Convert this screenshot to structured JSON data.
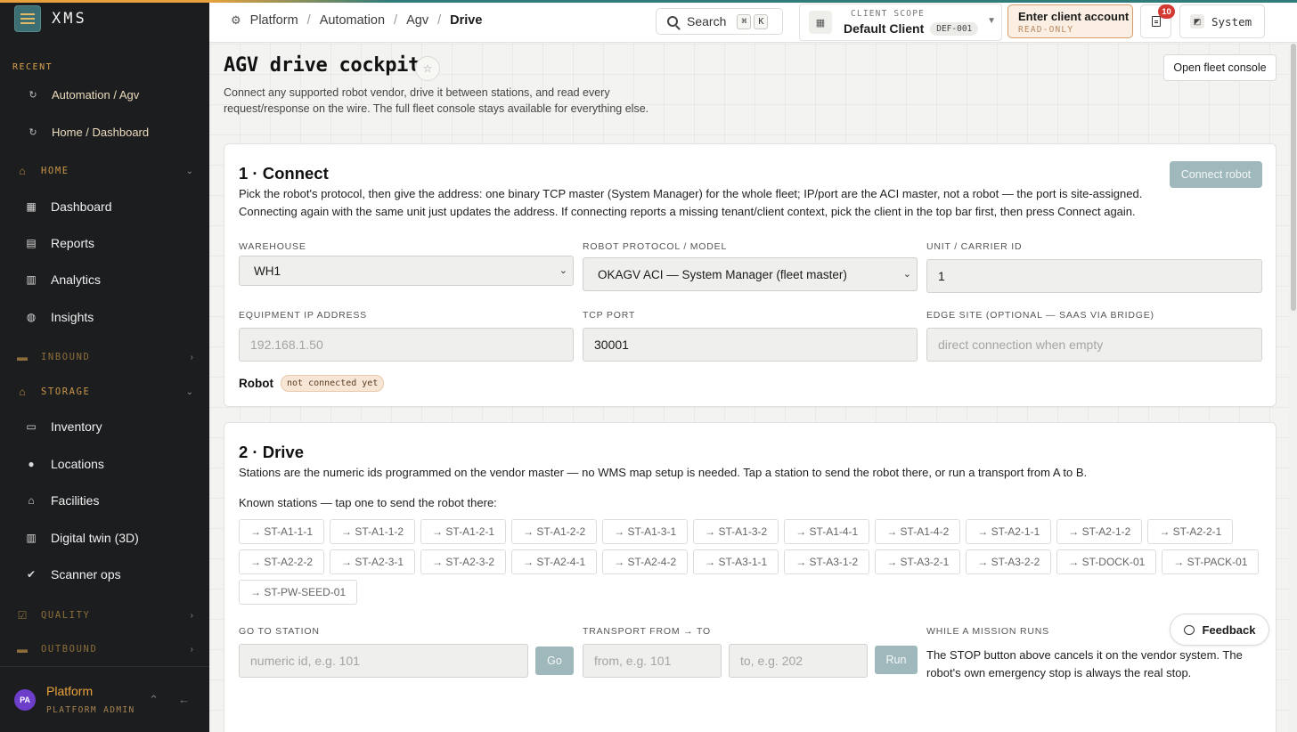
{
  "sidebar": {
    "brand": "XMS",
    "recent_label": "RECENT",
    "recent": [
      {
        "label": "Automation / Agv"
      },
      {
        "label": "Home / Dashboard"
      }
    ],
    "groups": {
      "home": "HOME",
      "inbound": "INBOUND",
      "storage": "STORAGE",
      "quality": "QUALITY",
      "outbound": "OUTBOUND"
    },
    "home_items": [
      {
        "label": "Dashboard",
        "icon": "grid-icon"
      },
      {
        "label": "Reports",
        "icon": "document-icon"
      },
      {
        "label": "Analytics",
        "icon": "bar-chart-icon"
      },
      {
        "label": "Insights",
        "icon": "globe-icon"
      }
    ],
    "storage_items": [
      {
        "label": "Inventory",
        "icon": "box-icon"
      },
      {
        "label": "Locations",
        "icon": "pin-icon"
      },
      {
        "label": "Facilities",
        "icon": "warehouse-icon"
      },
      {
        "label": "Digital twin (3D)",
        "icon": "chart-icon"
      },
      {
        "label": "Scanner ops",
        "icon": "shield-check-icon"
      }
    ],
    "user": {
      "initials": "PA",
      "name": "Platform",
      "role": "PLATFORM ADMIN"
    }
  },
  "topbar": {
    "breadcrumb": [
      "Platform",
      "Automation",
      "Agv",
      "Drive"
    ],
    "search_label": "Search",
    "search_keys": [
      "⌘",
      "K"
    ],
    "scope_label": "CLIENT SCOPE",
    "scope_value": "Default Client",
    "scope_code": "DEF-001",
    "enter_client": "Enter client account",
    "enter_client_sub": "READ-ONLY",
    "notifications_count": "10",
    "system_label": "System"
  },
  "page": {
    "title": "AGV drive cockpit",
    "description": "Connect any supported robot vendor, drive it between stations, and read every request/response on the wire. The full fleet console stays available for everything else.",
    "fleet_button": "Open fleet console"
  },
  "connect": {
    "title": "1 · Connect",
    "description": "Pick the robot's protocol, then give the address: one binary TCP master (System Manager) for the whole fleet; IP/port are the ACI master, not a robot — the port is site-assigned. Connecting again with the same unit just updates the address. If connecting reports a missing tenant/client context, pick the client in the top bar first, then press Connect again.",
    "button": "Connect robot",
    "warehouse_label": "WAREHOUSE",
    "warehouse_value": "WH1",
    "protocol_label": "ROBOT PROTOCOL / MODEL",
    "protocol_value": "OKAGV ACI — System Manager (fleet master)",
    "unit_label": "UNIT / CARRIER ID",
    "unit_value": "1",
    "ip_label": "EQUIPMENT IP ADDRESS",
    "ip_placeholder": "192.168.1.50",
    "port_label": "TCP PORT",
    "port_value": "30001",
    "edge_label": "EDGE SITE (OPTIONAL — SAAS VIA BRIDGE)",
    "edge_placeholder": "direct connection when empty",
    "robot_label": "Robot",
    "robot_status": "not connected yet"
  },
  "drive": {
    "title": "2 · Drive",
    "description": "Stations are the numeric ids programmed on the vendor master — no WMS map setup is needed. Tap a station to send the robot there, or run a transport from A to B.",
    "stations_heading": "Known stations — tap one to send the robot there:",
    "stations": [
      "→ ST-A1-1-1",
      "→ ST-A1-1-2",
      "→ ST-A1-2-1",
      "→ ST-A1-2-2",
      "→ ST-A1-3-1",
      "→ ST-A1-3-2",
      "→ ST-A1-4-1",
      "→ ST-A1-4-2",
      "→ ST-A2-1-1",
      "→ ST-A2-1-2",
      "→ ST-A2-2-1",
      "→ ST-A2-2-2",
      "→ ST-A2-3-1",
      "→ ST-A2-3-2",
      "→ ST-A2-4-1",
      "→ ST-A2-4-2",
      "→ ST-A3-1-1",
      "→ ST-A3-1-2",
      "→ ST-A3-2-1",
      "→ ST-A3-2-2",
      "→ ST-DOCK-01",
      "→ ST-PACK-01",
      "→ ST-PW-SEED-01"
    ],
    "goto_label": "GO TO STATION",
    "goto_placeholder": "numeric id, e.g. 101",
    "go_button": "Go",
    "transport_label": "TRANSPORT FROM → TO",
    "from_placeholder": "from, e.g. 101",
    "to_placeholder": "to, e.g. 202",
    "run_button": "Run",
    "mission_label": "WHILE A MISSION RUNS",
    "mission_text": "The STOP button above cancels it on the vendor system. The robot's own emergency stop is always the real stop."
  },
  "feedback": "Feedback",
  "colors": {
    "accent": "#e9a23b",
    "teal": "#2f7c7a",
    "sidebar_bg": "#1c1d1f",
    "disabled_button": "#9fb8bc"
  }
}
